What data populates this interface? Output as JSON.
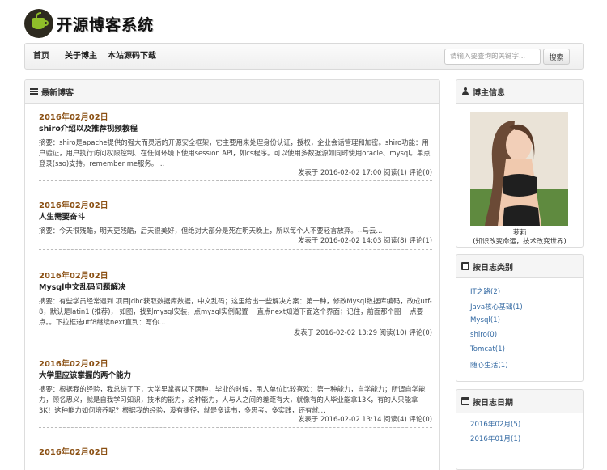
{
  "site": {
    "title": "开源博客系统"
  },
  "nav": {
    "items": [
      "首页",
      "关于博主",
      "本站源码下载"
    ],
    "search_placeholder": "请输入要查询的关键字...",
    "search_button": "搜索"
  },
  "main": {
    "heading": "最新博客",
    "posts": [
      {
        "date": "2016年02月02日",
        "title": "shiro介绍以及推荐视频教程",
        "summary": "摘要：shiro是apache提供的强大而灵活的开源安全框架，它主要用来处理身份认证，授权，企业会话管理和加密。shiro功能：用户验证，用户执行访问权限控制、在任何环境下使用session API，如cs程序。可以使用多数据源如同时使用oracle、mysql。单点登录(sso)支持。remember me服务。...",
        "meta": "发表于 2016-02-02 17:00 阅读(1) 评论(0)"
      },
      {
        "date": "2016年02月02日",
        "title": "人生需要奋斗",
        "summary": "摘要：今天很残酷，明天更残酷，后天很美好，但绝对大部分是死在明天晚上，所以每个人不要轻言放弃。--马云...",
        "meta": "发表于 2016-02-02 14:03 阅读(8) 评论(1)"
      },
      {
        "date": "2016年02月02日",
        "title": "Mysql中文乱码问题解决",
        "summary": "摘要：有些学员经常遇到 项目jdbc获取数据库数据，中文乱码；这里给出一些解决方案：第一种，修改Mysql数据库编码，改成utf-8，默认是latin1 (推荐)， 如图，找到mysql安装，点mysql实例配置 一直点next知道下面这个界面；记住，前面那个圈 一点要点。。下拉框选utf8继续next直到：写你...",
        "meta": "发表于 2016-02-02 13:29 阅读(10) 评论(0)"
      },
      {
        "date": "2016年02月02日",
        "title": "大学里应该掌握的两个能力",
        "summary": "摘要：根据我的经验，我总结了下，大学里掌握以下两种，毕业的时候，用人单位比较喜欢：第一种能力，自学能力；所谓自学能力，顾名思义，就是自我学习知识，技术的能力，这种能力，人与人之间的差距有大，就像有的人毕业能拿13K，有的人只能拿3K！这种能力如何培养呢？根据我的经验，没有捷径，就是多读书，多思考，多实践，还有就...",
        "meta": "发表于 2016-02-02 13:14 阅读(4) 评论(0)"
      },
      {
        "date": "2016年02月02日",
        "title": "",
        "summary": "",
        "meta": ""
      }
    ]
  },
  "blogger": {
    "heading": "博主信息",
    "name": "萝莉",
    "motto": "(知识改变命运，技术改变世界)"
  },
  "categories": {
    "heading": "按日志类别",
    "items": [
      "IT之路(2)",
      "Java核心基础(1)",
      "Mysql(1)",
      "shiro(0)",
      "Tomcat(1)",
      "随心生活(1)"
    ]
  },
  "archive": {
    "heading": "按日志日期",
    "items": [
      "2016年02月(5)",
      "2016年01月(1)"
    ]
  }
}
